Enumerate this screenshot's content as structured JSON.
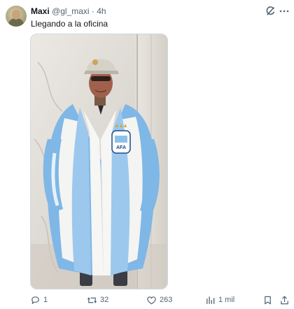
{
  "tweet": {
    "author_name": "Maxi",
    "author_handle": "@gl_maxi",
    "separator": "·",
    "time": "4h",
    "text": "Llegando a la oficina",
    "media_alt": "Man wearing a sky-blue and white striped fur coat with Argentina crest, cap and sunglasses"
  },
  "actions": {
    "replies": "1",
    "retweets": "32",
    "likes": "263",
    "views": "1 mil"
  },
  "colors": {
    "text": "#0f1419",
    "secondary": "#536471",
    "coat_blue": "#7fb7e6",
    "coat_white": "#f4f4f2"
  },
  "icons": {
    "header": [
      "grok-icon",
      "more-icon"
    ],
    "actions": [
      "reply-icon",
      "retweet-icon",
      "like-icon",
      "views-icon",
      "bookmark-icon",
      "share-icon"
    ]
  }
}
